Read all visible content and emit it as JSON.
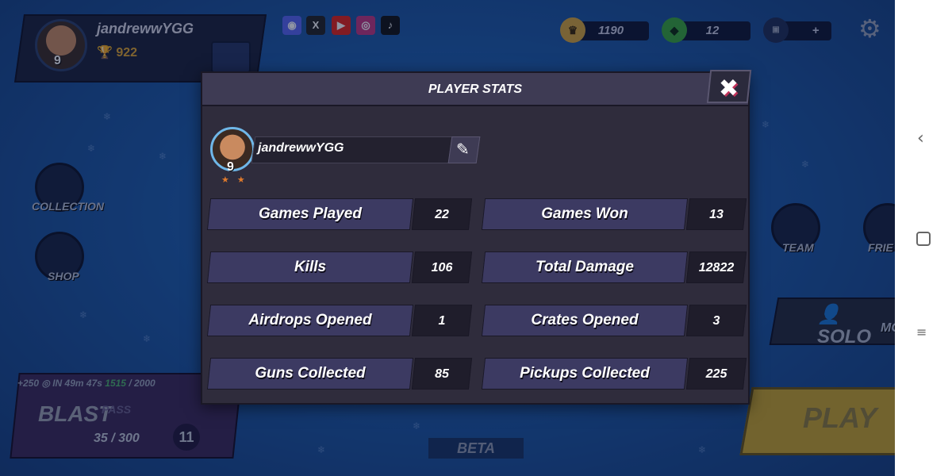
{
  "hud": {
    "username": "jandrewwYGG",
    "level": "9",
    "trophies": "922",
    "currencies": [
      {
        "icon": "crown-coin-icon",
        "value": "1190"
      },
      {
        "icon": "gem-coin-icon",
        "value": "12"
      },
      {
        "icon": "ad-token-icon",
        "value": "+"
      }
    ],
    "socials": [
      {
        "name": "discord-icon",
        "glyph": "◉",
        "color": "#5865f2"
      },
      {
        "name": "x-icon",
        "glyph": "X",
        "color": "#222222"
      },
      {
        "name": "youtube-icon",
        "glyph": "▶",
        "color": "#e62117"
      },
      {
        "name": "instagram-icon",
        "glyph": "◎",
        "color": "#c1357f"
      },
      {
        "name": "tiktok-icon",
        "glyph": "♪",
        "color": "#111111"
      }
    ]
  },
  "side_menu": {
    "collection": "COLLECTION",
    "shop": "SHOP",
    "team": "TEAM",
    "friends": "FRIE"
  },
  "mode": {
    "solo": "SOLO",
    "mode_cut": "MC",
    "play": "PLAY"
  },
  "pass": {
    "bonus": "+250",
    "timer": "IN 49m 47s",
    "points": "1515",
    "points_total": "/ 2000",
    "title": "BLAST",
    "subtitle": "PASS",
    "progress": "35 / 300",
    "level": "11"
  },
  "beta": "BETA",
  "modal": {
    "title": "PLAYER STATS",
    "username": "jandrewwYGG",
    "level": "9",
    "stats": [
      {
        "label": "Games Played",
        "value": "22"
      },
      {
        "label": "Games Won",
        "value": "13"
      },
      {
        "label": "Kills",
        "value": "106"
      },
      {
        "label": "Total Damage",
        "value": "12822"
      },
      {
        "label": "Airdrops Opened",
        "value": "1"
      },
      {
        "label": "Crates Opened",
        "value": "3"
      },
      {
        "label": "Guns Collected",
        "value": "85"
      },
      {
        "label": "Pickups Collected",
        "value": "225"
      }
    ]
  },
  "colors": {
    "background": "#1d5aa8",
    "modal": "#2f2c3c",
    "stat_label": "#3c3a62",
    "stat_value": "#1f1d2b",
    "accent_close": "#c0325a"
  }
}
